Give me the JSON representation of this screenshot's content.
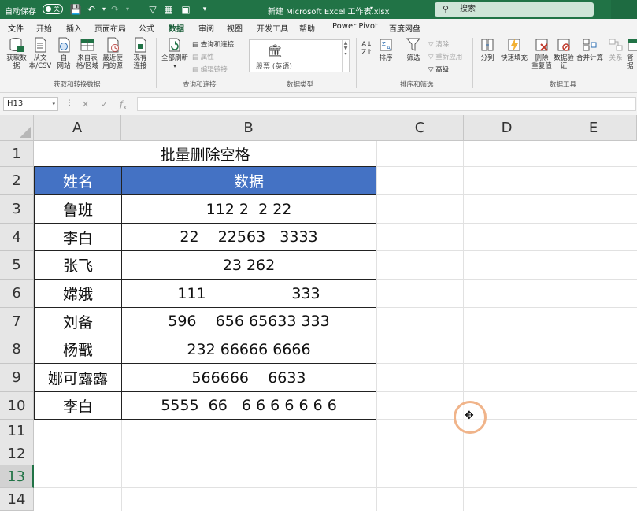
{
  "titlebar": {
    "autosave_label": "自动保存",
    "autosave_state": "关",
    "doc_title": "新建 Microsoft Excel 工作表.xlsx",
    "search_placeholder": "搜索"
  },
  "tabs": [
    "文件",
    "开始",
    "插入",
    "页面布局",
    "公式",
    "数据",
    "审阅",
    "视图",
    "开发工具",
    "帮助",
    "Power Pivot",
    "百度网盘"
  ],
  "active_tab": "数据",
  "ribbon": {
    "get_data": "获取数\n据",
    "from_text": "从文\n本/CSV",
    "from_web": "自\n网站",
    "from_table": "来自表\n格/区域",
    "recent_sources": "最近使\n用的源",
    "existing_conn": "现有\n连接",
    "group_get": "获取和转换数据",
    "refresh_all": "全部刷新",
    "queries_conn": "查询和连接",
    "properties": "属性",
    "edit_links": "编辑链接",
    "group_queries": "查询和连接",
    "stocks": "股票 (英语)",
    "group_types": "数据类型",
    "sort": "排序",
    "filter": "筛选",
    "clear": "清除",
    "reapply": "重新应用",
    "advanced": "高级",
    "group_sort": "排序和筛选",
    "split": "分列",
    "flash_fill": "快速填充",
    "remove_dup": "删除\n重复值",
    "validation": "数据验\n证",
    "consolidate": "合并计算",
    "relations": "关系",
    "manage_model": "管\n据",
    "group_tools": "数据工具"
  },
  "formula_bar": {
    "name_box": "H13",
    "formula": ""
  },
  "columns": [
    "A",
    "B",
    "C",
    "D",
    "E"
  ],
  "rows": [
    "1",
    "2",
    "3",
    "4",
    "5",
    "6",
    "7",
    "8",
    "9",
    "10",
    "11",
    "12",
    "13",
    "14"
  ],
  "selected_row": "13",
  "sheet": {
    "title": "批量删除空格",
    "header_name": "姓名",
    "header_data": "数据",
    "records": [
      {
        "name": "鲁班",
        "data": "112 2  2 22"
      },
      {
        "name": "李白",
        "data": "22    22563   3333"
      },
      {
        "name": "张飞",
        "data": "23 262"
      },
      {
        "name": "嫦娥",
        "data": "111                  333"
      },
      {
        "name": "刘备",
        "data": "596    656 65633 333"
      },
      {
        "name": "杨戬",
        "data": "232 66666 6666"
      },
      {
        "name": "娜可露露",
        "data": "566666    6633"
      },
      {
        "name": "李白",
        "data": "5555  66   6 6 6 6 6 6 6"
      }
    ]
  },
  "colors": {
    "excel_green": "#217346",
    "header_fill": "#4472c4"
  }
}
